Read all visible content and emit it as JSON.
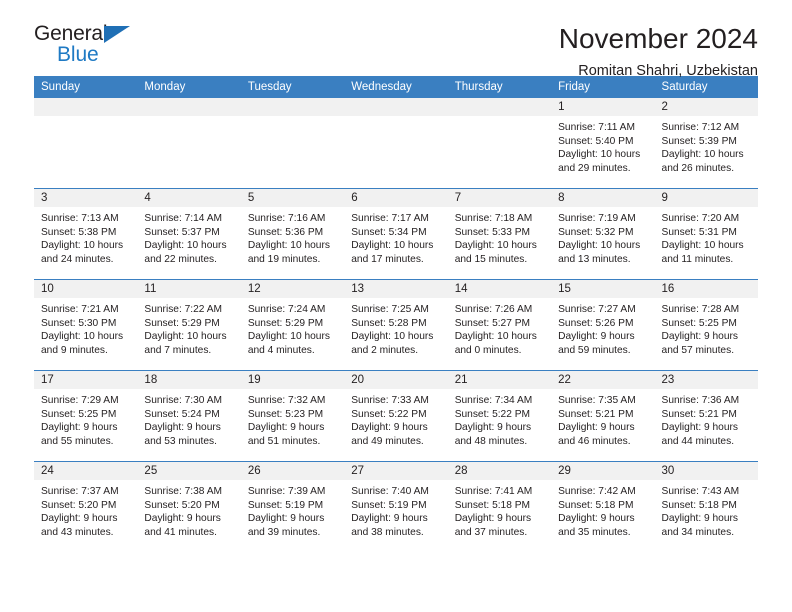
{
  "brand": {
    "name_top": "General",
    "name_bottom": "Blue",
    "accent_color": "#1f7ac4",
    "triangle_color": "#1f6fb5"
  },
  "header": {
    "title": "November 2024",
    "subtitle": "Romitan Shahri, Uzbekistan"
  },
  "calendar": {
    "header_bg": "#3a7fc1",
    "daynum_bg": "#f1f1f1",
    "weekdays": [
      "Sunday",
      "Monday",
      "Tuesday",
      "Wednesday",
      "Thursday",
      "Friday",
      "Saturday"
    ],
    "weeks": [
      [
        {
          "day": "",
          "empty": true
        },
        {
          "day": "",
          "empty": true
        },
        {
          "day": "",
          "empty": true
        },
        {
          "day": "",
          "empty": true
        },
        {
          "day": "",
          "empty": true
        },
        {
          "day": "1",
          "sunrise": "Sunrise: 7:11 AM",
          "sunset": "Sunset: 5:40 PM",
          "daylight": "Daylight: 10 hours and 29 minutes."
        },
        {
          "day": "2",
          "sunrise": "Sunrise: 7:12 AM",
          "sunset": "Sunset: 5:39 PM",
          "daylight": "Daylight: 10 hours and 26 minutes."
        }
      ],
      [
        {
          "day": "3",
          "sunrise": "Sunrise: 7:13 AM",
          "sunset": "Sunset: 5:38 PM",
          "daylight": "Daylight: 10 hours and 24 minutes."
        },
        {
          "day": "4",
          "sunrise": "Sunrise: 7:14 AM",
          "sunset": "Sunset: 5:37 PM",
          "daylight": "Daylight: 10 hours and 22 minutes."
        },
        {
          "day": "5",
          "sunrise": "Sunrise: 7:16 AM",
          "sunset": "Sunset: 5:36 PM",
          "daylight": "Daylight: 10 hours and 19 minutes."
        },
        {
          "day": "6",
          "sunrise": "Sunrise: 7:17 AM",
          "sunset": "Sunset: 5:34 PM",
          "daylight": "Daylight: 10 hours and 17 minutes."
        },
        {
          "day": "7",
          "sunrise": "Sunrise: 7:18 AM",
          "sunset": "Sunset: 5:33 PM",
          "daylight": "Daylight: 10 hours and 15 minutes."
        },
        {
          "day": "8",
          "sunrise": "Sunrise: 7:19 AM",
          "sunset": "Sunset: 5:32 PM",
          "daylight": "Daylight: 10 hours and 13 minutes."
        },
        {
          "day": "9",
          "sunrise": "Sunrise: 7:20 AM",
          "sunset": "Sunset: 5:31 PM",
          "daylight": "Daylight: 10 hours and 11 minutes."
        }
      ],
      [
        {
          "day": "10",
          "sunrise": "Sunrise: 7:21 AM",
          "sunset": "Sunset: 5:30 PM",
          "daylight": "Daylight: 10 hours and 9 minutes."
        },
        {
          "day": "11",
          "sunrise": "Sunrise: 7:22 AM",
          "sunset": "Sunset: 5:29 PM",
          "daylight": "Daylight: 10 hours and 7 minutes."
        },
        {
          "day": "12",
          "sunrise": "Sunrise: 7:24 AM",
          "sunset": "Sunset: 5:29 PM",
          "daylight": "Daylight: 10 hours and 4 minutes."
        },
        {
          "day": "13",
          "sunrise": "Sunrise: 7:25 AM",
          "sunset": "Sunset: 5:28 PM",
          "daylight": "Daylight: 10 hours and 2 minutes."
        },
        {
          "day": "14",
          "sunrise": "Sunrise: 7:26 AM",
          "sunset": "Sunset: 5:27 PM",
          "daylight": "Daylight: 10 hours and 0 minutes."
        },
        {
          "day": "15",
          "sunrise": "Sunrise: 7:27 AM",
          "sunset": "Sunset: 5:26 PM",
          "daylight": "Daylight: 9 hours and 59 minutes."
        },
        {
          "day": "16",
          "sunrise": "Sunrise: 7:28 AM",
          "sunset": "Sunset: 5:25 PM",
          "daylight": "Daylight: 9 hours and 57 minutes."
        }
      ],
      [
        {
          "day": "17",
          "sunrise": "Sunrise: 7:29 AM",
          "sunset": "Sunset: 5:25 PM",
          "daylight": "Daylight: 9 hours and 55 minutes."
        },
        {
          "day": "18",
          "sunrise": "Sunrise: 7:30 AM",
          "sunset": "Sunset: 5:24 PM",
          "daylight": "Daylight: 9 hours and 53 minutes."
        },
        {
          "day": "19",
          "sunrise": "Sunrise: 7:32 AM",
          "sunset": "Sunset: 5:23 PM",
          "daylight": "Daylight: 9 hours and 51 minutes."
        },
        {
          "day": "20",
          "sunrise": "Sunrise: 7:33 AM",
          "sunset": "Sunset: 5:22 PM",
          "daylight": "Daylight: 9 hours and 49 minutes."
        },
        {
          "day": "21",
          "sunrise": "Sunrise: 7:34 AM",
          "sunset": "Sunset: 5:22 PM",
          "daylight": "Daylight: 9 hours and 48 minutes."
        },
        {
          "day": "22",
          "sunrise": "Sunrise: 7:35 AM",
          "sunset": "Sunset: 5:21 PM",
          "daylight": "Daylight: 9 hours and 46 minutes."
        },
        {
          "day": "23",
          "sunrise": "Sunrise: 7:36 AM",
          "sunset": "Sunset: 5:21 PM",
          "daylight": "Daylight: 9 hours and 44 minutes."
        }
      ],
      [
        {
          "day": "24",
          "sunrise": "Sunrise: 7:37 AM",
          "sunset": "Sunset: 5:20 PM",
          "daylight": "Daylight: 9 hours and 43 minutes."
        },
        {
          "day": "25",
          "sunrise": "Sunrise: 7:38 AM",
          "sunset": "Sunset: 5:20 PM",
          "daylight": "Daylight: 9 hours and 41 minutes."
        },
        {
          "day": "26",
          "sunrise": "Sunrise: 7:39 AM",
          "sunset": "Sunset: 5:19 PM",
          "daylight": "Daylight: 9 hours and 39 minutes."
        },
        {
          "day": "27",
          "sunrise": "Sunrise: 7:40 AM",
          "sunset": "Sunset: 5:19 PM",
          "daylight": "Daylight: 9 hours and 38 minutes."
        },
        {
          "day": "28",
          "sunrise": "Sunrise: 7:41 AM",
          "sunset": "Sunset: 5:18 PM",
          "daylight": "Daylight: 9 hours and 37 minutes."
        },
        {
          "day": "29",
          "sunrise": "Sunrise: 7:42 AM",
          "sunset": "Sunset: 5:18 PM",
          "daylight": "Daylight: 9 hours and 35 minutes."
        },
        {
          "day": "30",
          "sunrise": "Sunrise: 7:43 AM",
          "sunset": "Sunset: 5:18 PM",
          "daylight": "Daylight: 9 hours and 34 minutes."
        }
      ]
    ]
  }
}
